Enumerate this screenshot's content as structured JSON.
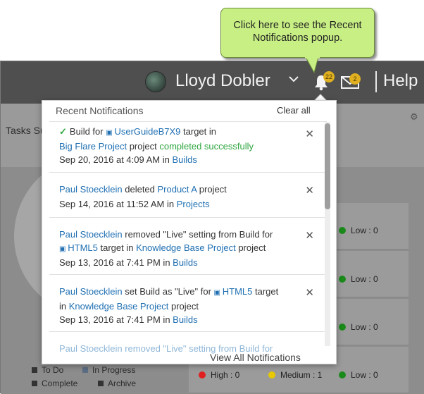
{
  "callout": {
    "text": "Click here to see the Recent Notifications popup."
  },
  "header": {
    "user_name": "Lloyd Dobler",
    "notifications_count": "22",
    "messages_count": "2",
    "help_label": "Help",
    "icons": [
      "avatar",
      "chevron-down-icon",
      "bell-icon",
      "mail-icon"
    ]
  },
  "background": {
    "tasks_title": "Tasks Su",
    "legend": [
      {
        "label": "To Do",
        "color": "#333333"
      },
      {
        "label": "In Progress",
        "color": "#5c6e84"
      },
      {
        "label": "Complete",
        "color": "#333333"
      },
      {
        "label": "Archive",
        "color": "#333333"
      }
    ],
    "stats": {
      "high": "High : 0",
      "medium": "Medium : 1",
      "low_rows": [
        "Low : 0",
        "Low : 0",
        "Low : 0",
        "Low : 0"
      ]
    },
    "colors": {
      "high": "#e02020",
      "medium": "#e8c800",
      "low": "#1a8a1a"
    }
  },
  "popup": {
    "title": "Recent Notifications",
    "clear_all": "Clear all",
    "view_all": "View All Notifications",
    "notifications": [
      {
        "line1": [
          "Build for ",
          "UserGuideB7X9",
          " target in"
        ],
        "line2": [
          "Big Flare Project",
          " project ",
          "completed successfully"
        ],
        "date": "Sep 20, 2016 at 4:09 AM in ",
        "area": "Builds"
      },
      {
        "line1": [
          "Paul Stoecklein",
          " deleted ",
          "Product A",
          " project"
        ],
        "date": "Sep 14, 2016 at 11:52 AM in ",
        "area": "Projects"
      },
      {
        "line1": [
          "Paul Stoecklein",
          " removed \"Live\" setting from Build for"
        ],
        "line2": [
          "HTML5",
          " target in ",
          "Knowledge Base Project",
          " project"
        ],
        "date": "Sep 13, 2016 at 7:41 PM in ",
        "area": "Builds"
      },
      {
        "line1": [
          "Paul Stoecklein",
          " set Build as \"Live\" for ",
          "HTML5",
          " target"
        ],
        "line2": [
          "in ",
          "Knowledge Base Project",
          " project"
        ],
        "date": "Sep 13, 2016 at 7:41 PM in ",
        "area": "Builds"
      }
    ],
    "partial_row": "Paul Stoecklein   removed \"Live\" setting from Build for"
  }
}
